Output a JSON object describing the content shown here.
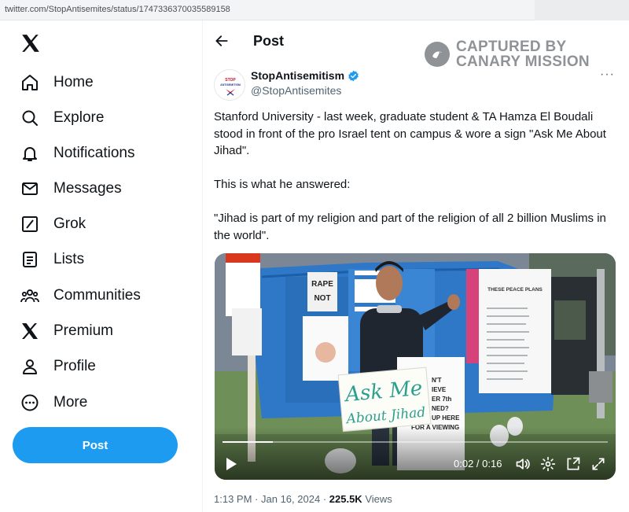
{
  "browser": {
    "url": "twitter.com/StopAntisemites/status/1747336370035589158"
  },
  "sidebar": {
    "items": [
      {
        "label": "Home",
        "icon": "home-icon"
      },
      {
        "label": "Explore",
        "icon": "search-icon"
      },
      {
        "label": "Notifications",
        "icon": "bell-icon"
      },
      {
        "label": "Messages",
        "icon": "envelope-icon"
      },
      {
        "label": "Grok",
        "icon": "grok-icon"
      },
      {
        "label": "Lists",
        "icon": "list-icon"
      },
      {
        "label": "Communities",
        "icon": "people-icon"
      },
      {
        "label": "Premium",
        "icon": "x-logo-icon"
      },
      {
        "label": "Profile",
        "icon": "person-icon"
      },
      {
        "label": "More",
        "icon": "more-circle-icon"
      }
    ],
    "post_button": "Post"
  },
  "header": {
    "title": "Post"
  },
  "watermark": {
    "line1": "CAPTURED BY",
    "line2": "CANARY MISSION"
  },
  "tweet": {
    "author_name": "StopAntisemitism",
    "handle": "@StopAntisemites",
    "avatar_text_1": "STOP",
    "avatar_text_2": "ANTISEMITISM",
    "more": "···",
    "paragraphs": [
      "Stanford University - last week, graduate student & TA Hamza El Boudali stood in front of the pro Israel tent on campus & wore a sign \"Ask Me About Jihad\".",
      "This is what he answered:",
      "\"Jihad is part of my religion and part of the religion of all 2 billion Muslims in the world\"."
    ],
    "time": "1:13 PM",
    "date": "Jan 16, 2024",
    "views_count": "225.5K",
    "views_label": "Views"
  },
  "video": {
    "current_time": "0:02",
    "duration": "0:16",
    "progress": 0.13,
    "sign_line1": "Ask Me",
    "sign_line2": "About Jihad",
    "poster_rape": "RAPE",
    "poster_not": "NOT",
    "peace_title": "THESE PEACE PLANS",
    "flyer_lines": [
      "N'T",
      "IEVE",
      "ER 7th",
      "NED?",
      "UP HERE",
      "FOR A VIEWING"
    ]
  },
  "colors": {
    "accent": "#1d9bf0",
    "text": "#0f1419",
    "muted": "#536471"
  }
}
